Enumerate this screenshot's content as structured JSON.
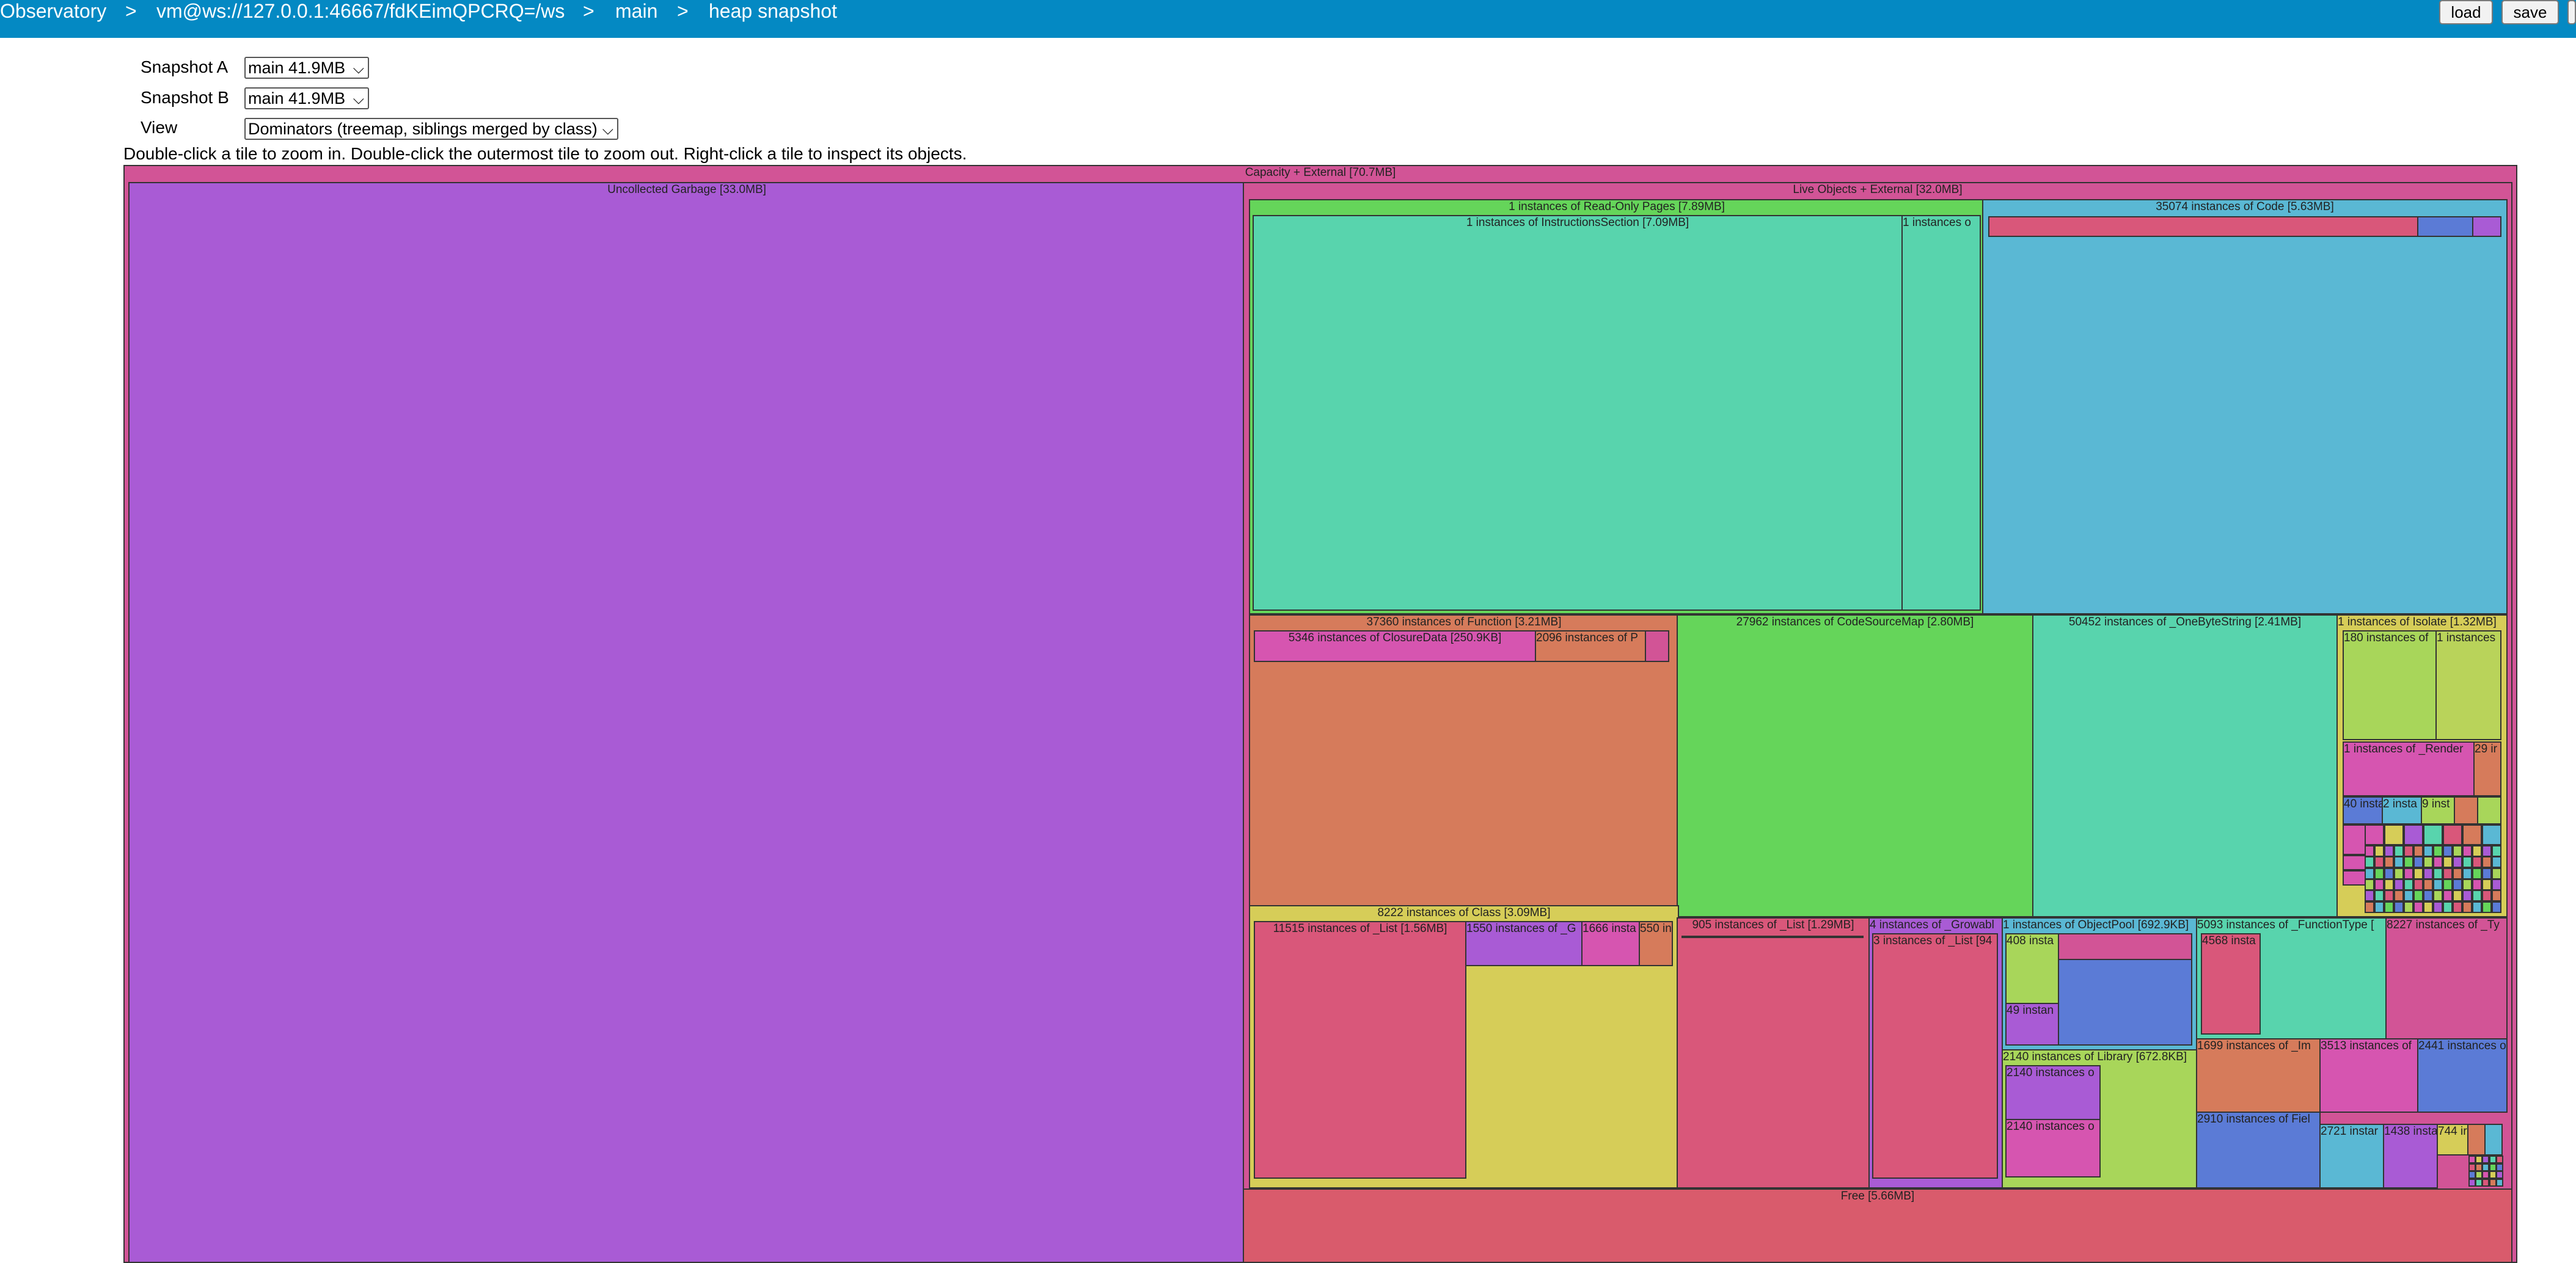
{
  "topbar": {
    "crumbs": [
      "Observatory",
      "vm@ws://127.0.0.1:46667/fdKEimQPCRQ=/ws",
      "main",
      "heap snapshot"
    ],
    "separator": ">",
    "load_label": "load",
    "save_label": "save"
  },
  "controls": {
    "snapshot_a_label": "Snapshot A",
    "snapshot_a_value": "main 41.9MB",
    "snapshot_b_label": "Snapshot B",
    "snapshot_b_value": "main 41.9MB",
    "view_label": "View",
    "view_value": "Dominators (treemap, siblings merged by class)"
  },
  "help_text": "Double-click a tile to zoom in. Double-click the outermost tile to zoom out. Right-click a tile to inspect its objects.",
  "colors": {
    "topbar": "#0489c3",
    "magenta": "#d25496",
    "purple": "#a95bd5",
    "green": "#65d55a",
    "teal": "#58d4ad",
    "sky": "#5ab8d4",
    "orange": "#d67b5b",
    "pink": "#d9577a",
    "yellow": "#d6cd58",
    "blue": "#5b7bd6",
    "lime": "#a8d65a",
    "salmon": "#d95b6c",
    "rose": "#d655b0",
    "olive": "#b9d35a"
  },
  "treemap": {
    "root": "Capacity + External [70.7MB]",
    "garbage": "Uncollected Garbage [33.0MB]",
    "live": "Live Objects + External [32.0MB]",
    "readonly": "1 instances of Read-Only Pages [7.89MB]",
    "instructions": "1 instances of InstructionsSection [7.09MB]",
    "readonly_small": "1 instances o",
    "code": "35074 instances of Code [5.63MB]",
    "function": "37360 instances of Function [3.21MB]",
    "closuredata": "5346 instances of ClosureData [250.9KB]",
    "fn_2096": "2096 instances of P",
    "codesourcemap": "27962 instances of CodeSourceMap [2.80MB]",
    "onebytestring": "50452 instances of _OneByteString [2.41MB]",
    "isolate": "1 instances of Isolate [1.32MB]",
    "iso_180": "180 instances of",
    "iso_1": "1 instances",
    "iso_render": "1 instances of _Render",
    "iso_29": "29 ir",
    "iso_40": "40 insta",
    "iso_2": "2 insta",
    "iso_9": "9 inst",
    "class": "8222 instances of Class [3.09MB]",
    "class_list": "11515 instances of _List [1.56MB]",
    "class_1550": "1550 instances of _G",
    "class_1666": "1666 insta",
    "class_550": "550 in",
    "list905": "905 instances of _List [1.29MB]",
    "growable": "4 instances of _Growabl",
    "growable_list": "3 instances of _List [94",
    "objectpool": "1 instances of ObjectPool [692.9KB]",
    "op_408": "408 insta",
    "op_49": "49 instan",
    "functiontype": "5093 instances of _FunctionType [",
    "ft_4568": "4568 insta",
    "type_8227": "8227 instances of _Ty",
    "library": "2140 instances of Library [672.8KB]",
    "lib_a": "2140 instances o",
    "lib_b": "2140 instances o",
    "im_1699": "1699 instances of _Im",
    "m_3513": "3513 instances of",
    "m_2441": "2441 instances o",
    "m_2910": "2910 instances of Fiel",
    "m_2721": "2721 instar",
    "m_1438": "1438 insta",
    "m_744": "744 ir",
    "free": "Free [5.66MB]"
  }
}
